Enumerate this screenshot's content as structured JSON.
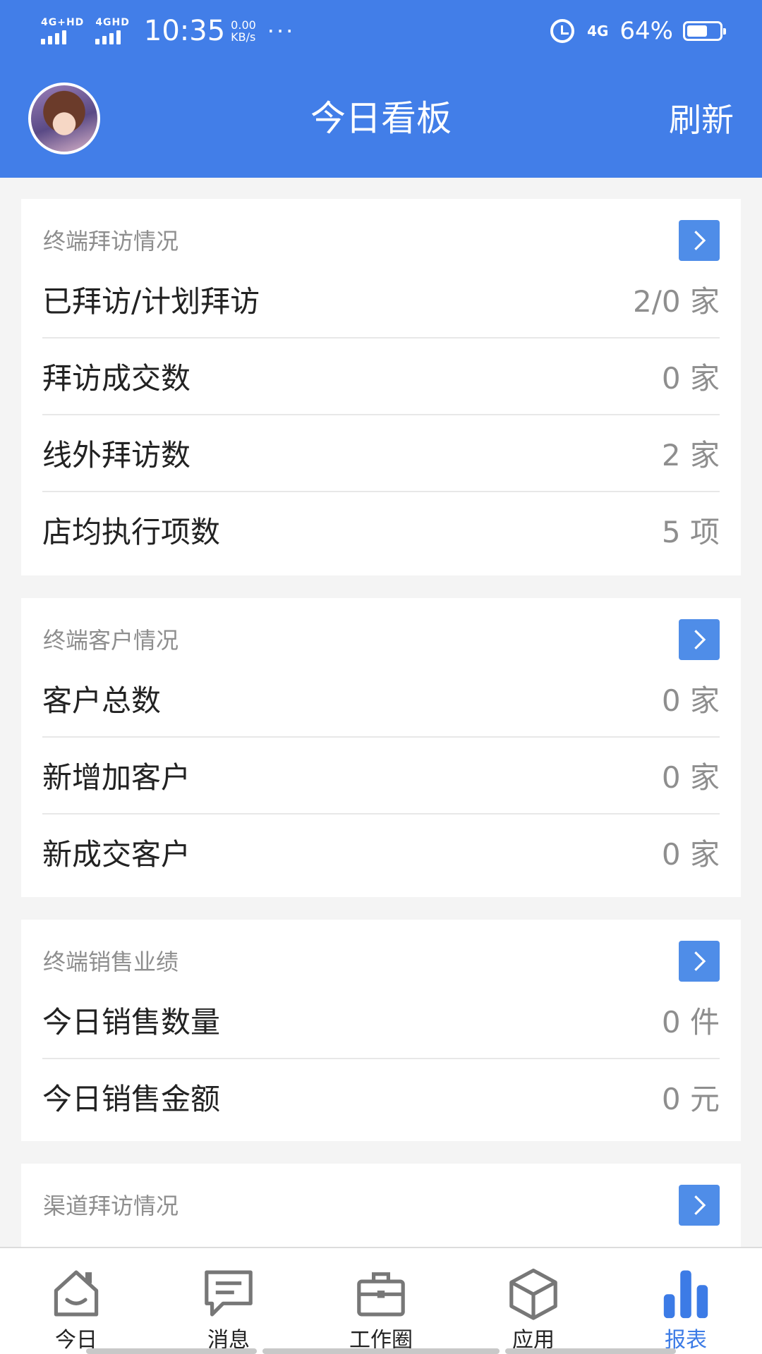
{
  "status_bar": {
    "sim1": "4G+HD",
    "sim2": "4GHD",
    "time": "10:35",
    "net_speed_value": "0.00",
    "net_speed_unit": "KB/s",
    "more": "···",
    "network": "4G",
    "battery": "64%",
    "battery_level": 0.64
  },
  "header": {
    "title": "今日看板",
    "refresh": "刷新"
  },
  "cards": [
    {
      "title": "终端拜访情况",
      "rows": [
        {
          "label": "已拜访/计划拜访",
          "value": "2/0 家"
        },
        {
          "label": "拜访成交数",
          "value": "0 家"
        },
        {
          "label": "线外拜访数",
          "value": "2 家"
        },
        {
          "label": "店均执行项数",
          "value": "5 项"
        }
      ]
    },
    {
      "title": "终端客户情况",
      "rows": [
        {
          "label": "客户总数",
          "value": "0 家"
        },
        {
          "label": "新增加客户",
          "value": "0 家"
        },
        {
          "label": "新成交客户",
          "value": "0 家"
        }
      ]
    },
    {
      "title": "终端销售业绩",
      "rows": [
        {
          "label": "今日销售数量",
          "value": "0 件"
        },
        {
          "label": "今日销售金额",
          "value": "0 元"
        }
      ]
    },
    {
      "title": "渠道拜访情况",
      "rows": []
    }
  ],
  "nav": [
    {
      "label": "今日",
      "icon": "home-icon"
    },
    {
      "label": "消息",
      "icon": "message-icon"
    },
    {
      "label": "工作圈",
      "icon": "briefcase-icon"
    },
    {
      "label": "应用",
      "icon": "cube-icon"
    },
    {
      "label": "报表",
      "icon": "bar-chart-icon",
      "active": true
    }
  ],
  "colors": {
    "header_bg": "#427ee8",
    "accent": "#4f8de8",
    "active_tab": "#3c7be6"
  }
}
